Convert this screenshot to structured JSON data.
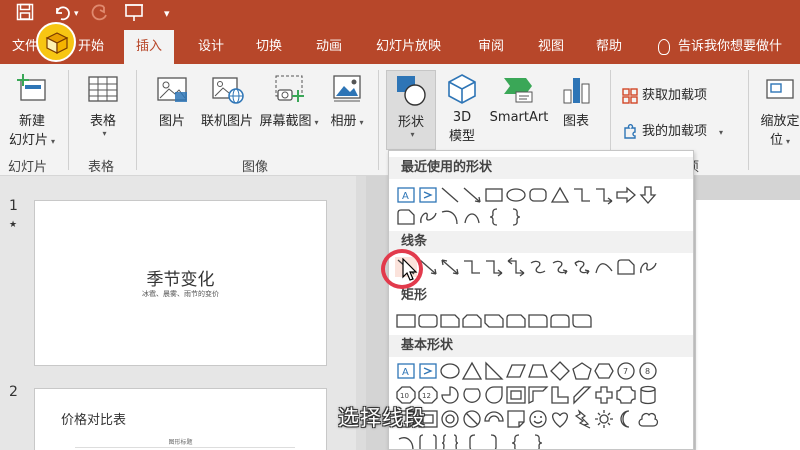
{
  "tabs": [
    {
      "label": "文件",
      "active": false
    },
    {
      "label": "开始",
      "active": false
    },
    {
      "label": "插入",
      "active": true
    },
    {
      "label": "设计",
      "active": false
    },
    {
      "label": "切换",
      "active": false
    },
    {
      "label": "动画",
      "active": false
    },
    {
      "label": "幻灯片放映",
      "active": false
    },
    {
      "label": "审阅",
      "active": false
    },
    {
      "label": "视图",
      "active": false
    },
    {
      "label": "帮助",
      "active": false
    }
  ],
  "tell_me": "告诉我你想要做什",
  "ribbon": {
    "new_slide_line1": "新建",
    "new_slide_line2": "幻灯片",
    "table": "表格",
    "picture": "图片",
    "online_picture": "联机图片",
    "screenshot": "屏幕截图",
    "album": "相册",
    "shapes": "形状",
    "model3d_line1": "3D",
    "model3d_line2": "模型",
    "smartart": "SmartArt",
    "chart": "图表",
    "get_addins": "获取加载项",
    "my_addins": "我的加载项",
    "zoom_line1": "缩放定",
    "zoom_line2": "位",
    "groups": {
      "slides": "幻灯片",
      "tables": "表格",
      "images": "图像",
      "addins_tail": "项"
    }
  },
  "slides": [
    {
      "number": "1",
      "title": "季节变化",
      "subtitle": "冰雹、晨雾、雨节的变价"
    },
    {
      "number": "2",
      "title": "价格对比表",
      "subtitle": "图形标题"
    }
  ],
  "shapes_menu": {
    "recent": "最近使用的形状",
    "lines": "线条",
    "rect": "矩形",
    "basic": "基本形状"
  },
  "caption": "选择线段",
  "colors": {
    "brand": "#b7472a",
    "highlight": "#e23a4c",
    "shape_blue": "#2e75b6"
  }
}
